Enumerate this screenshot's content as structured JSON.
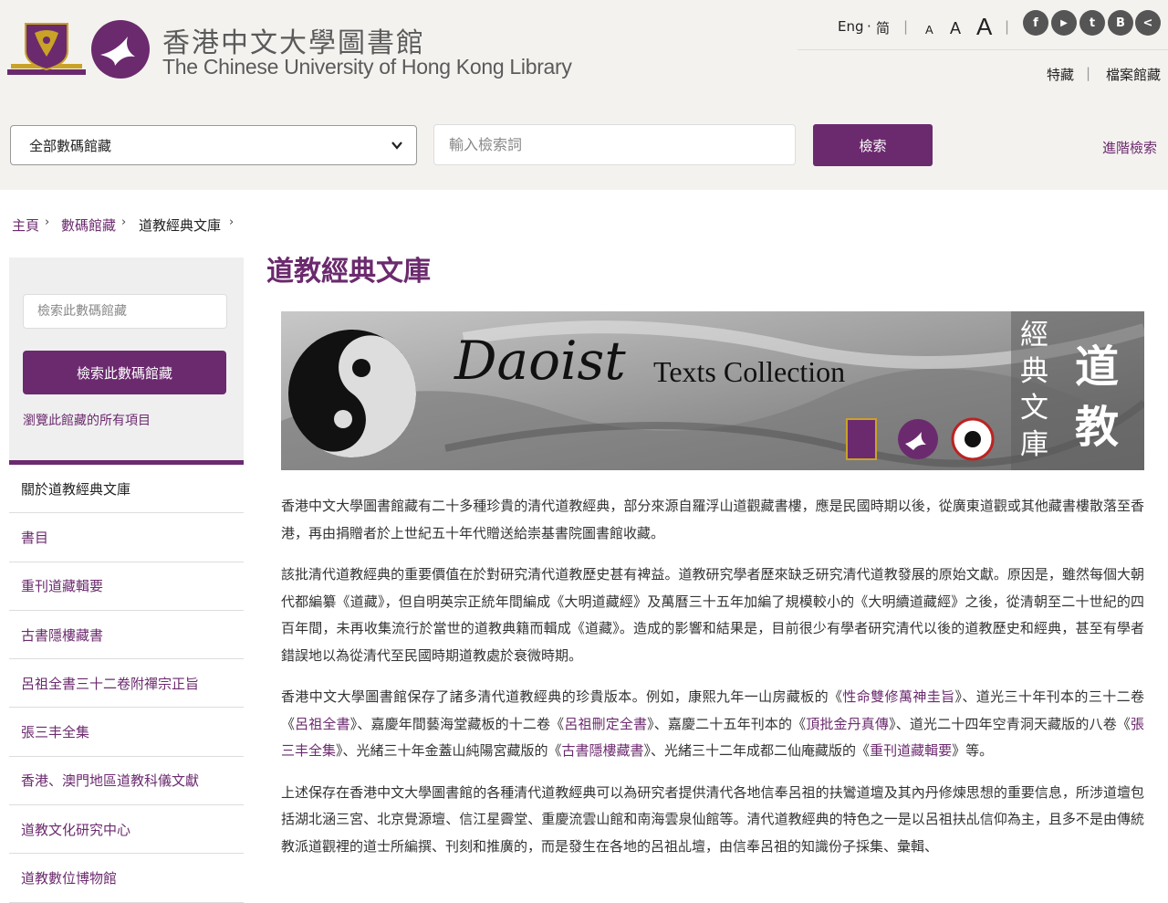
{
  "header": {
    "logo_cn": "香港中文大學圖書館",
    "logo_en": "The Chinese University of Hong Kong Library",
    "lang_eng": "Eng",
    "lang_sep": "·",
    "lang_simp": "简",
    "font_small": "A",
    "font_medium": "A",
    "font_large": "A",
    "social": [
      {
        "icon": "facebook-icon",
        "glyph": "f"
      },
      {
        "icon": "youtube-icon",
        "glyph": "▶"
      },
      {
        "icon": "twitter-icon",
        "glyph": "t"
      },
      {
        "icon": "blog-icon",
        "glyph": "B"
      },
      {
        "icon": "share-icon",
        "glyph": "<"
      }
    ],
    "link_special": "特藏",
    "link_archive": "檔案館藏"
  },
  "search": {
    "scope_value": "全部數碼館藏",
    "placeholder": "輸入檢索詞",
    "button": "檢索",
    "advanced": "進階檢索"
  },
  "breadcrumb": {
    "home": "主頁",
    "digital": "數碼館藏",
    "current": "道教經典文庫",
    "separator": "›"
  },
  "sidebar": {
    "search_placeholder": "檢索此數碼館藏",
    "search_button": "檢索此數碼館藏",
    "browse_all": "瀏覽此館藏的所有項目",
    "items": [
      "關於道教經典文庫",
      "書目",
      "重刊道藏輯要",
      "古書隱樓藏書",
      "呂祖全書三十二卷附禪宗正旨",
      "張三丰全集",
      "香港、澳門地區道教科儀文獻",
      "道教文化研究中心",
      "道教數位博物館"
    ]
  },
  "main": {
    "title": "道教經典文庫",
    "banner": {
      "script": "Daoist",
      "caption": "Texts Collection",
      "vertical_1": "經典文庫",
      "vertical_2": "道教"
    },
    "paragraphs": {
      "p1": "香港中文大學圖書館藏有二十多種珍貴的清代道教經典，部分來源自羅浮山道觀藏書樓，應是民國時期以後，從廣東道觀或其他藏書樓散落至香港，再由捐贈者於上世紀五十年代贈送給崇基書院圖書館收藏。",
      "p2": "該批清代道教經典的重要價值在於對研究清代道教歷史甚有裨益。道教研究學者歷來缺乏研究清代道教發展的原始文獻。原因是，雖然每個大朝代都編纂《道藏》，但自明英宗正統年間編成《大明道藏經》及萬曆三十五年加編了規模較小的《大明續道藏經》之後，從清朝至二十世紀的四百年間，未再收集流行於當世的道教典籍而輯成《道藏》。造成的影響和結果是，目前很少有學者研究清代以後的道教歷史和經典，甚至有學者錯誤地以為從清代至民國時期道教處於衰微時期。",
      "p3": {
        "s1": "香港中文大學圖書館保存了諸多清代道教經典的珍貴版本。例如，康熙九年一山房藏板的《",
        "l1": "性命雙修萬神圭旨",
        "s2": "》、道光三十年刊本的三十二卷《",
        "l2": "呂祖全書",
        "s3": "》、嘉慶年間藝海堂藏板的十二卷《",
        "l3": "呂祖刪定全書",
        "s4": "》、嘉慶二十五年刊本的《",
        "l4": "頂批金丹真傳",
        "s5": "》、道光二十四年空青洞天藏版的八卷《",
        "l5": "張三丰全集",
        "s6": "》、光緒三十年金蓋山純陽宮藏版的《",
        "l6": "古書隱樓藏書",
        "s7": "》、光緒三十二年成都二仙庵藏版的《",
        "l7": "重刊道藏輯要",
        "s8": "》等。"
      },
      "p4": "上述保存在香港中文大學圖書館的各種清代道教經典可以為研究者提供清代各地信奉呂祖的扶鸞道壇及其內丹修煉思想的重要信息，所涉道壇包括湖北涵三宮、北京覺源壇、信江星霽堂、重慶流雲山館和南海雲泉仙館等。清代道教經典的特色之一是以呂祖扶乩信仰為主，且多不是由傳統教派道觀裡的道士所編撰、刊刻和推廣的，而是發生在各地的呂祖乩壇，由信奉呂祖的知識份子採集、彙輯、"
    }
  },
  "colors": {
    "brand": "#6b2a6e",
    "header_bg": "#f4f2ef",
    "sidebar_bg": "#efefef"
  }
}
